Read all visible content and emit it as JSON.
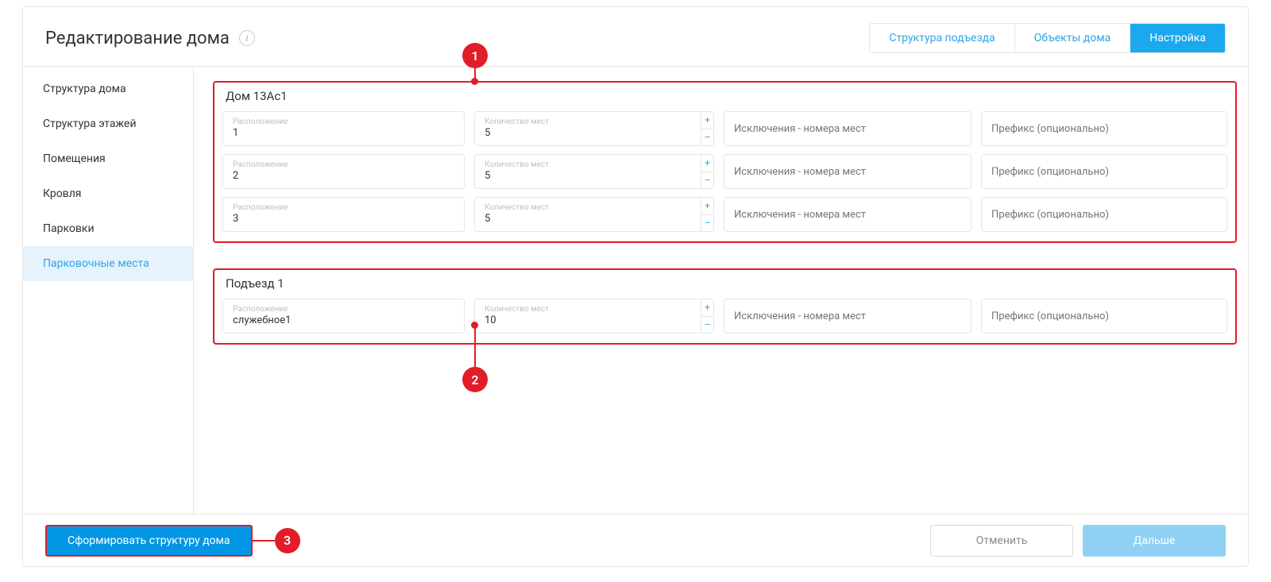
{
  "header": {
    "title": "Редактирование дома",
    "info_symbol": "i",
    "tabs": [
      {
        "label": "Структура подъезда"
      },
      {
        "label": "Объекты дома"
      },
      {
        "label": "Настройка"
      }
    ]
  },
  "sidebar": {
    "items": [
      {
        "label": "Структура дома"
      },
      {
        "label": "Структура этажей"
      },
      {
        "label": "Помещения"
      },
      {
        "label": "Кровля"
      },
      {
        "label": "Парковки"
      },
      {
        "label": "Парковочные места"
      }
    ]
  },
  "labels": {
    "location": "Расположение",
    "count": "Количество мест",
    "exclusions_ph": "Исключения - номера мест",
    "prefix_ph": "Префикс (опционально)",
    "plus": "+",
    "minus": "–"
  },
  "groups": [
    {
      "title": "Дом 13Ас1",
      "rows": [
        {
          "location": "1",
          "count": "5"
        },
        {
          "location": "2",
          "count": "5"
        },
        {
          "location": "3",
          "count": "5"
        }
      ]
    },
    {
      "title": "Подъезд 1",
      "rows": [
        {
          "location": "служебное1",
          "count": "10"
        }
      ]
    }
  ],
  "callouts": {
    "c1": "1",
    "c2": "2",
    "c3": "3"
  },
  "footer": {
    "generate": "Сформировать структуру дома",
    "cancel": "Отменить",
    "next": "Дальше"
  }
}
